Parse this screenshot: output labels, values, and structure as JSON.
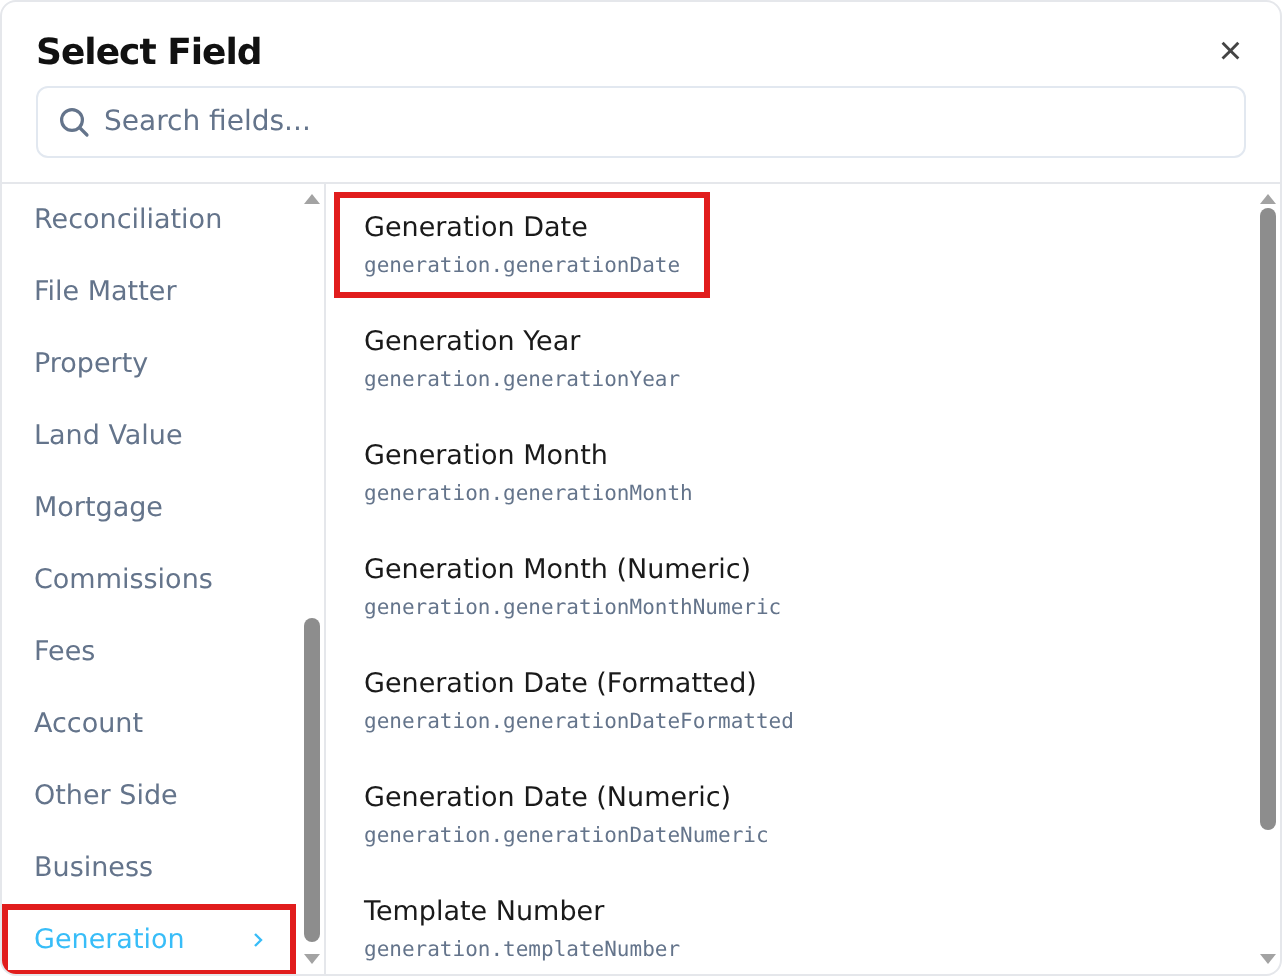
{
  "dialog": {
    "title": "Select Field",
    "close": "×"
  },
  "search": {
    "placeholder": "Search fields..."
  },
  "categories": [
    {
      "label": "Reconciliation",
      "selected": false,
      "highlighted": false
    },
    {
      "label": "File Matter",
      "selected": false,
      "highlighted": false
    },
    {
      "label": "Property",
      "selected": false,
      "highlighted": false
    },
    {
      "label": "Land Value",
      "selected": false,
      "highlighted": false
    },
    {
      "label": "Mortgage",
      "selected": false,
      "highlighted": false
    },
    {
      "label": "Commissions",
      "selected": false,
      "highlighted": false
    },
    {
      "label": "Fees",
      "selected": false,
      "highlighted": false
    },
    {
      "label": "Account",
      "selected": false,
      "highlighted": false
    },
    {
      "label": "Other Side",
      "selected": false,
      "highlighted": false
    },
    {
      "label": "Business",
      "selected": false,
      "highlighted": false
    },
    {
      "label": "Generation",
      "selected": true,
      "highlighted": true
    }
  ],
  "fields": [
    {
      "name": "Generation Date",
      "path": "generation.generationDate",
      "highlighted": true
    },
    {
      "name": "Generation Year",
      "path": "generation.generationYear",
      "highlighted": false
    },
    {
      "name": "Generation Month",
      "path": "generation.generationMonth",
      "highlighted": false
    },
    {
      "name": "Generation Month (Numeric)",
      "path": "generation.generationMonthNumeric",
      "highlighted": false
    },
    {
      "name": "Generation Date (Formatted)",
      "path": "generation.generationDateFormatted",
      "highlighted": false
    },
    {
      "name": "Generation Date (Numeric)",
      "path": "generation.generationDateNumeric",
      "highlighted": false
    },
    {
      "name": "Template Number",
      "path": "generation.templateNumber",
      "highlighted": false
    }
  ]
}
